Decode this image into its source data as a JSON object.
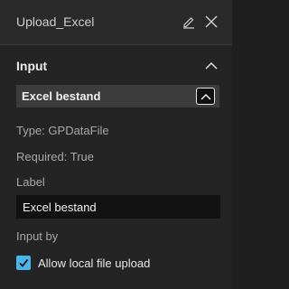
{
  "window": {
    "title": "Upload_Excel",
    "edit_icon": "pencil-icon",
    "close_icon": "close-icon"
  },
  "section": {
    "title": "Input",
    "chevron_icon": "chevron-up-icon"
  },
  "parameter": {
    "name": "Excel bestand",
    "toggle_icon": "chevron-up-icon",
    "type_text": "Type: GPDataFile",
    "required_text": "Required: True",
    "label_caption": "Label",
    "label_value": "Excel bestand",
    "input_by_caption": "Input by",
    "allow_upload": {
      "checked": true,
      "label": "Allow local file upload"
    }
  },
  "colors": {
    "background": "#242424",
    "param_bar": "#3c3c3c",
    "input_bg": "#121212",
    "checkbox_accent": "#48b6e8"
  }
}
